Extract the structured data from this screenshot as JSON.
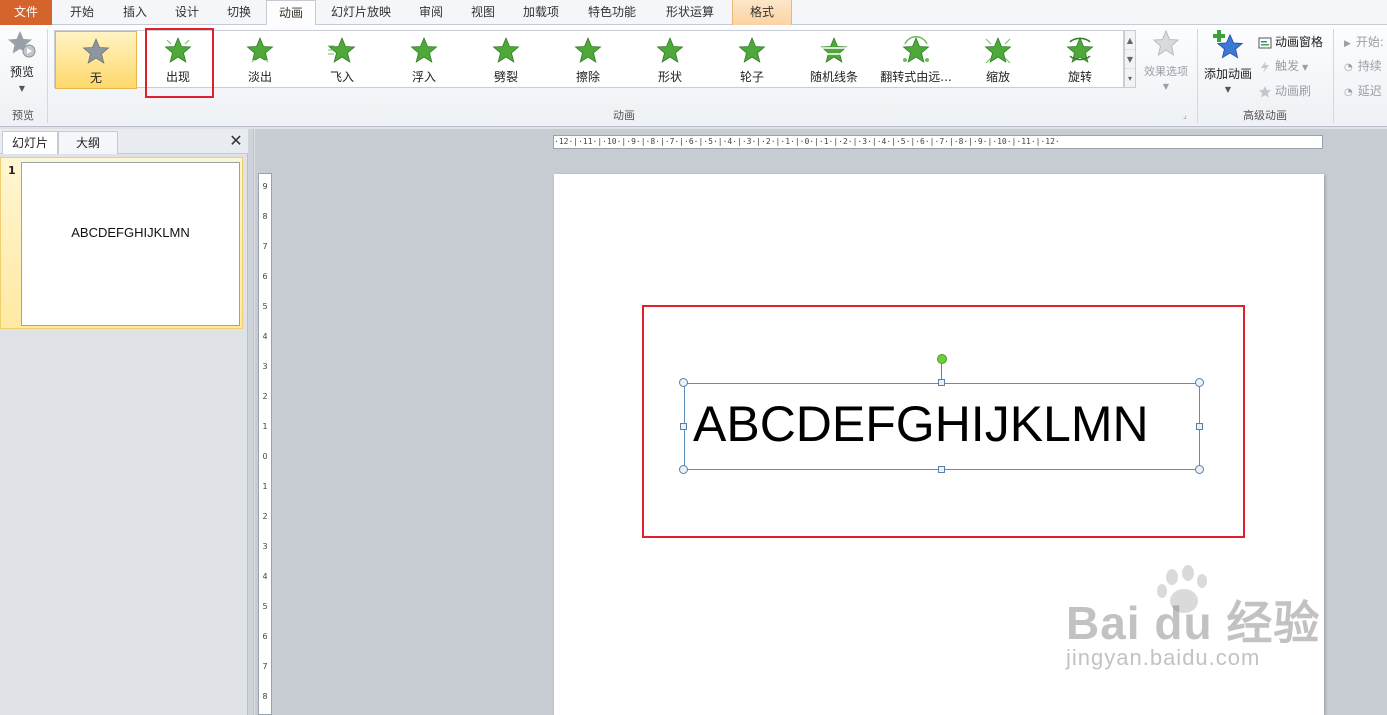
{
  "tabs": {
    "file": "文件",
    "home": "开始",
    "insert": "插入",
    "design": "设计",
    "transitions": "切换",
    "animations": "动画",
    "slideshow": "幻灯片放映",
    "review": "审阅",
    "view": "视图",
    "addins": "加载项",
    "features": "特色功能",
    "shape_ops": "形状运算",
    "format": "格式"
  },
  "ribbon": {
    "preview": {
      "label": "预览",
      "group_label": "预览"
    },
    "animation_group_label": "动画",
    "gallery": [
      "无",
      "出现",
      "淡出",
      "飞入",
      "浮入",
      "劈裂",
      "擦除",
      "形状",
      "轮子",
      "随机线条",
      "翻转式由远...",
      "缩放",
      "旋转"
    ],
    "gallery_selected": "无",
    "effect_options": "效果选项",
    "add_animation": "添加动画",
    "animation_pane": "动画窗格",
    "trigger": "触发",
    "animation_painter": "动画刷",
    "advanced_group_label": "高级动画",
    "timing": {
      "start": "开始:",
      "duration": "持续",
      "delay": "延迟"
    }
  },
  "colors": {
    "file_tab": "#d5632c",
    "highlight": "#e0202a",
    "selected_gallery": "#ffd86a",
    "star_green": "#4fa83a"
  },
  "left_panel": {
    "tab_slides": "幻灯片",
    "tab_outline": "大纲",
    "close": "✕",
    "slide_number": "1",
    "thumb_text": "ABCDEFGHIJKLMN"
  },
  "rulers": {
    "horizontal": "·12·|·11·|·10·|·9·|·8·|·7·|·6·|·5·|·4·|·3·|·2·|·1·|·0·|·1·|·2·|·3·|·4·|·5·|·6·|·7·|·8·|·9·|·10·|·11·|·12·",
    "vertical": [
      "9",
      "8",
      "7",
      "6",
      "5",
      "4",
      "3",
      "2",
      "1",
      "0",
      "1",
      "2",
      "3",
      "4",
      "5",
      "6",
      "7",
      "8"
    ]
  },
  "slide": {
    "text": "ABCDEFGHIJKLMN"
  },
  "watermark": {
    "main": "Bai du 经验",
    "sub": "jingyan.baidu.com"
  }
}
